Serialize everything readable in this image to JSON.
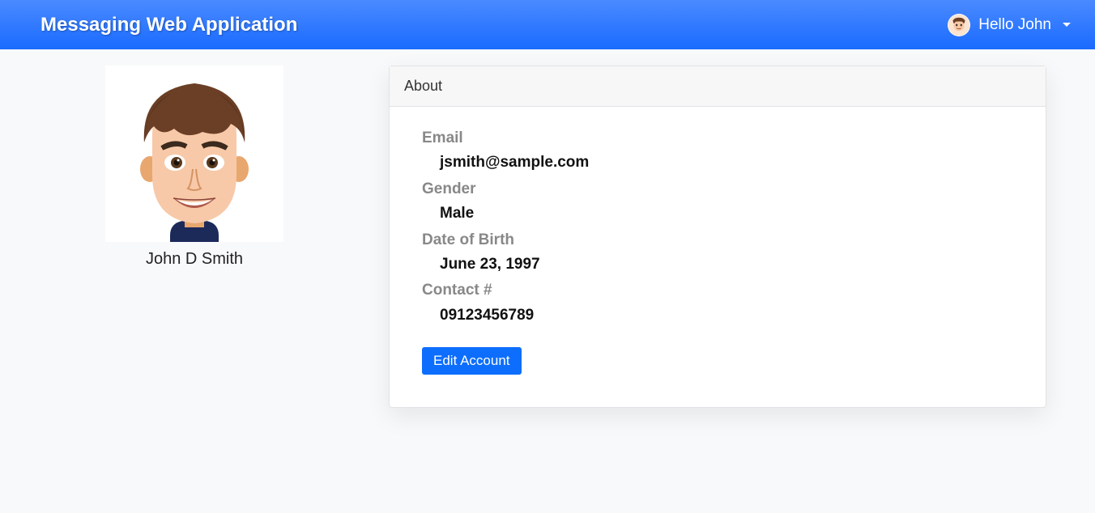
{
  "header": {
    "title": "Messaging Web Application",
    "greeting": "Hello John"
  },
  "profile": {
    "name": "John D Smith"
  },
  "about": {
    "title": "About",
    "email_label": "Email",
    "email_value": "jsmith@sample.com",
    "gender_label": "Gender",
    "gender_value": "Male",
    "dob_label": "Date of Birth",
    "dob_value": "June 23, 1997",
    "contact_label": "Contact #",
    "contact_value": "09123456789",
    "edit_label": "Edit Account"
  }
}
